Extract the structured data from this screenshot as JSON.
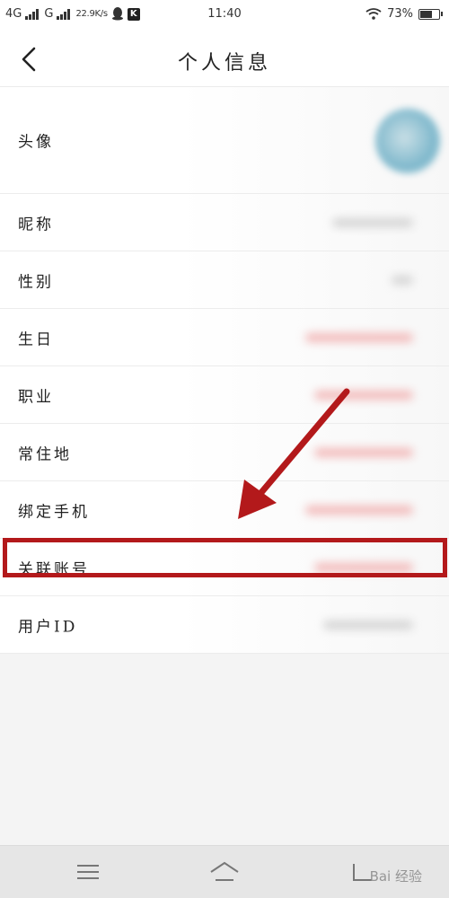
{
  "status_bar": {
    "net1": "4G",
    "net2": "G",
    "speed": "22.9K/s",
    "k_badge": "K",
    "time": "11:40",
    "battery": "73%",
    "battery_level": 0.73,
    "icons": [
      "signal-icon",
      "qq-icon",
      "wifi-icon",
      "battery-icon"
    ]
  },
  "header": {
    "title": "个人信息",
    "back_icon": "chevron-left-icon"
  },
  "rows": [
    {
      "label": "头像"
    },
    {
      "label": "昵称"
    },
    {
      "label": "性别"
    },
    {
      "label": "生日"
    },
    {
      "label": "职业"
    },
    {
      "label": "常住地"
    },
    {
      "label": "绑定手机"
    },
    {
      "label": "关联账号"
    },
    {
      "label": "用户ID"
    }
  ],
  "annotation": {
    "color": "#b3191b",
    "highlighted_row": "关联账号"
  },
  "nav": {
    "icons": [
      "menu-icon",
      "home-icon",
      "back-icon"
    ]
  },
  "watermark": "Bai 经验"
}
